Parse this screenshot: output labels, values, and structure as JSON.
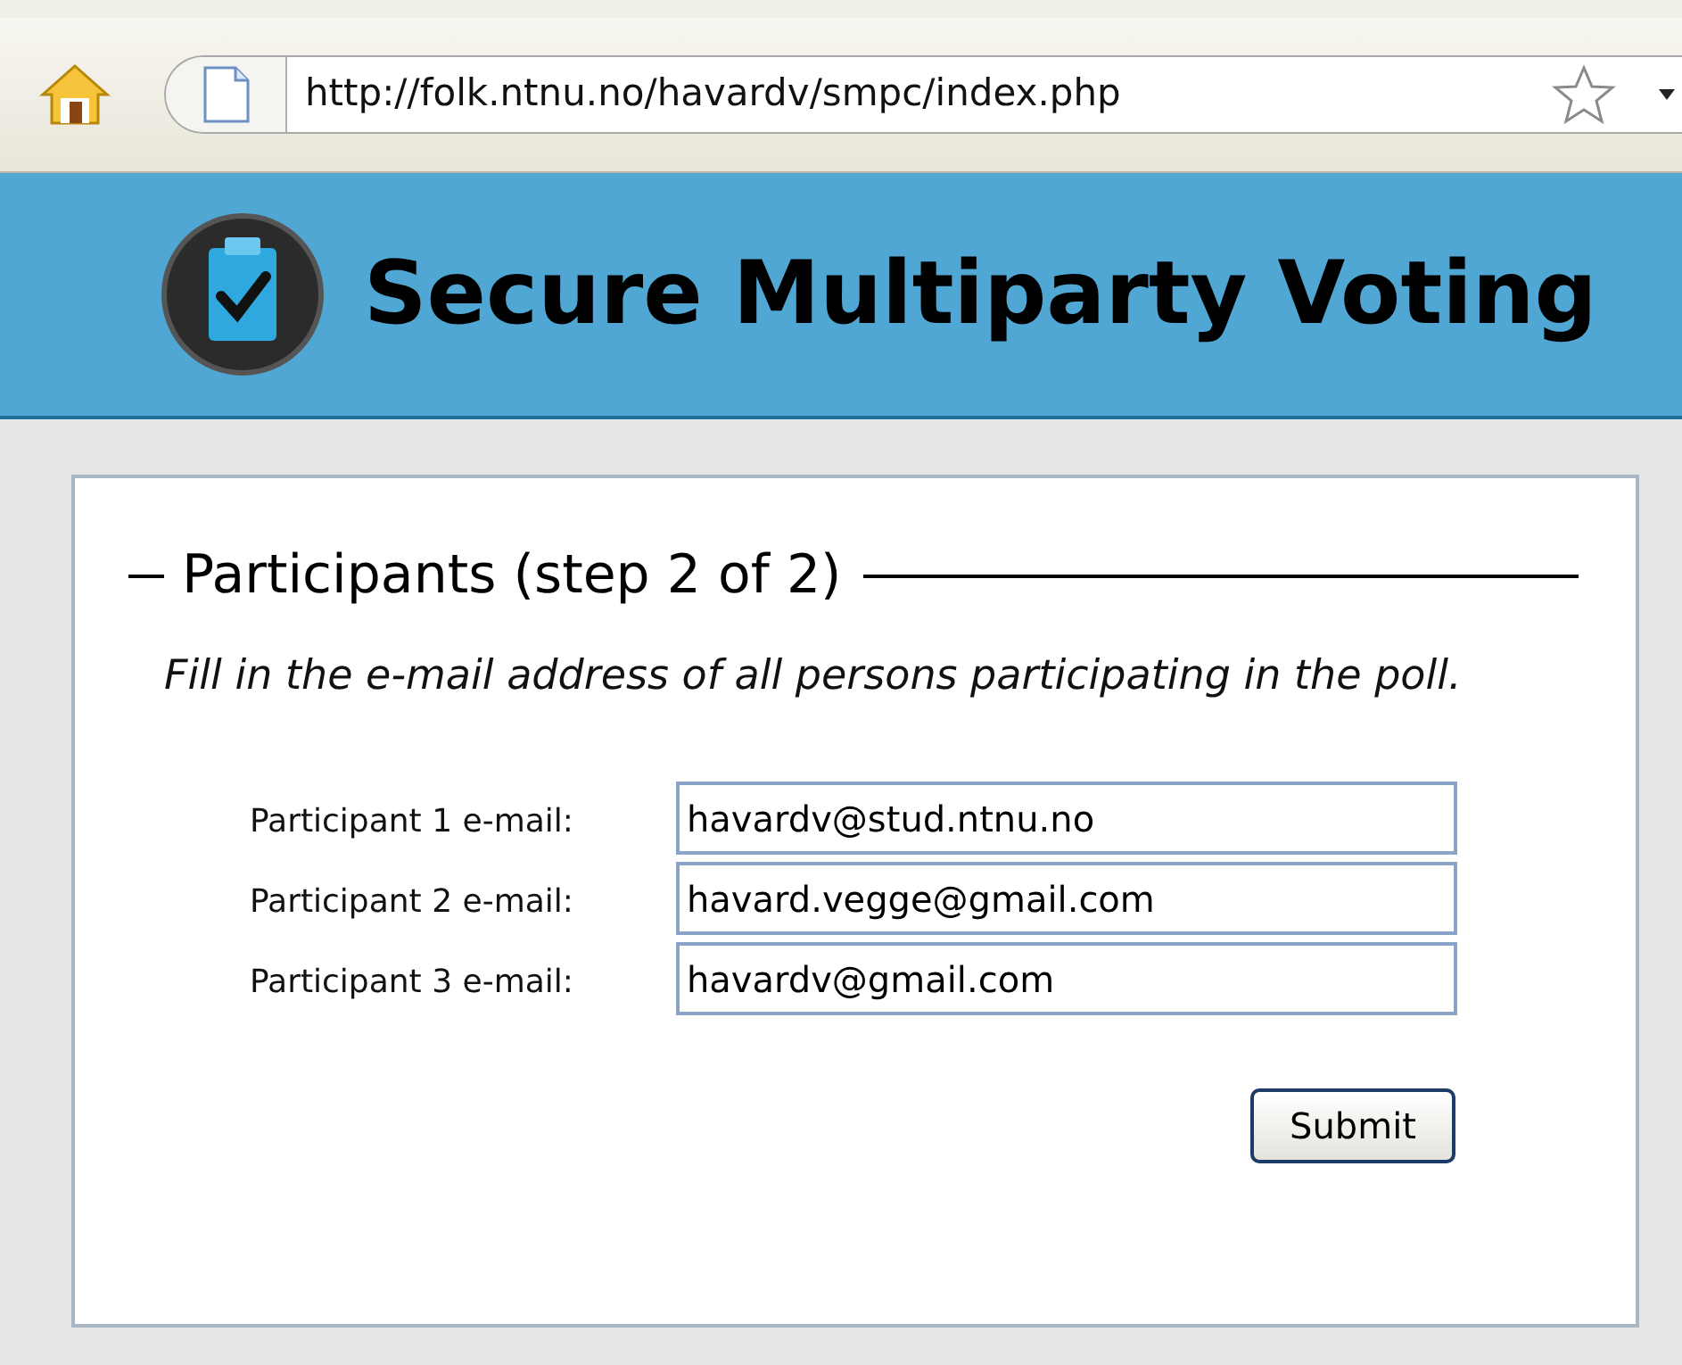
{
  "browser": {
    "url": "http://folk.ntnu.no/havardv/smpc/index.php"
  },
  "header": {
    "title": "Secure Multiparty Voting"
  },
  "form": {
    "legend": "Participants (step 2 of 2)",
    "description": "Fill in the e-mail address of all persons participating in the poll.",
    "fields": [
      {
        "label": "Participant 1 e-mail:",
        "value": "havardv@stud.ntnu.no"
      },
      {
        "label": "Participant 2 e-mail:",
        "value": "havard.vegge@gmail.com"
      },
      {
        "label": "Participant 3 e-mail:",
        "value": "havardv@gmail.com"
      }
    ],
    "submit": "Submit"
  }
}
